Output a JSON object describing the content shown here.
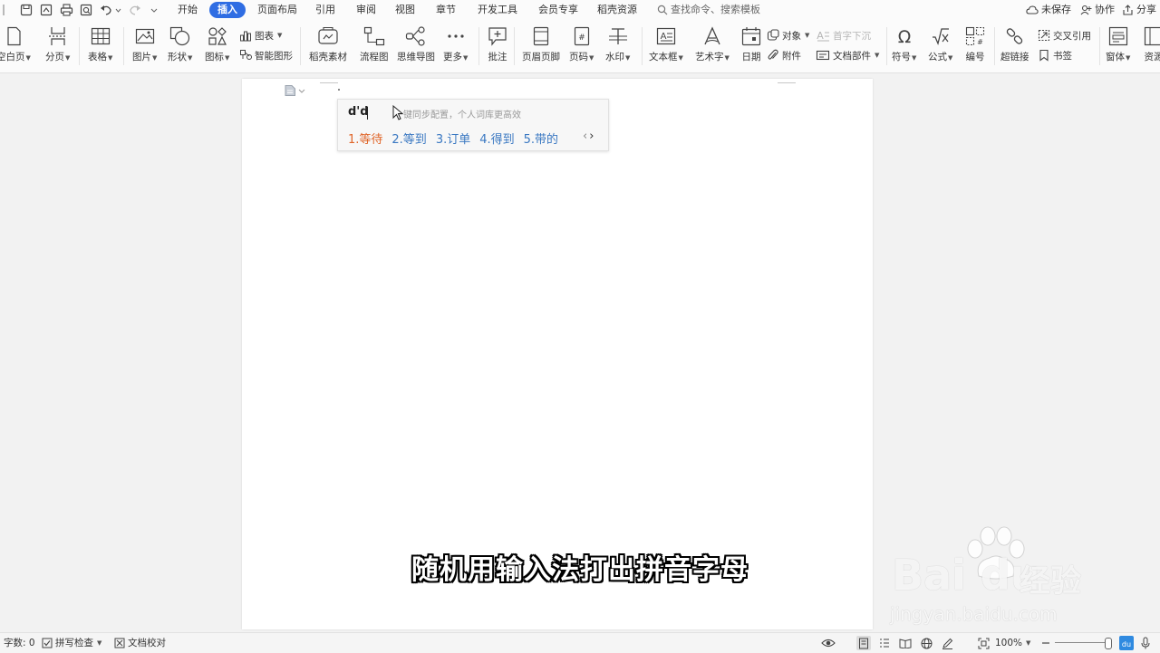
{
  "menubar": {
    "tabs": [
      "开始",
      "插入",
      "页面布局",
      "引用",
      "审阅",
      "视图",
      "章节",
      "开发工具",
      "会员专享",
      "稻壳资源"
    ],
    "active_tab": "插入",
    "search_placeholder": "查找命令、搜索模板",
    "unsaved": "未保存",
    "collaborate": "协作",
    "share": "分享"
  },
  "ribbon": {
    "blank_page": "空白页",
    "page_break": "分页",
    "table": "表格",
    "picture": "图片",
    "shape": "形状",
    "icon": "图标",
    "chart": "图表",
    "smart_art": "智能图形",
    "docer_material": "稻壳素材",
    "flowchart": "流程图",
    "mind_map": "思维导图",
    "more": "更多",
    "comment": "批注",
    "header_footer": "页眉页脚",
    "page_number": "页码",
    "watermark": "水印",
    "text_box": "文本框",
    "word_art": "艺术字",
    "date": "日期",
    "object": "对象",
    "drop_cap": "首字下沉",
    "attachment": "附件",
    "doc_parts": "文档部件",
    "symbol": "符号",
    "formula": "公式",
    "numbering": "编号",
    "hyperlink": "超链接",
    "cross_ref": "交叉引用",
    "bookmark": "书签",
    "window": "窗体",
    "resources": "资源"
  },
  "ime": {
    "composition": "d'd",
    "hint": "一键同步配置，个人词库更高效",
    "candidates": [
      "1.等待",
      "2.等到",
      "3.订单",
      "4.得到",
      "5.带的"
    ]
  },
  "subtitle": "随机用输入法打出拼音字母",
  "watermark": {
    "logo": "Bai  du",
    "jingyan": "经验",
    "url": "jingyan.baidu.com"
  },
  "status": {
    "word_count": "字数: 0",
    "spell_check": "拼写检查",
    "proofread": "文档校对",
    "zoom": "100%"
  },
  "colors": {
    "accent": "#2f6de3",
    "candidate_first": "#e0662a",
    "candidate": "#3a78c2"
  }
}
